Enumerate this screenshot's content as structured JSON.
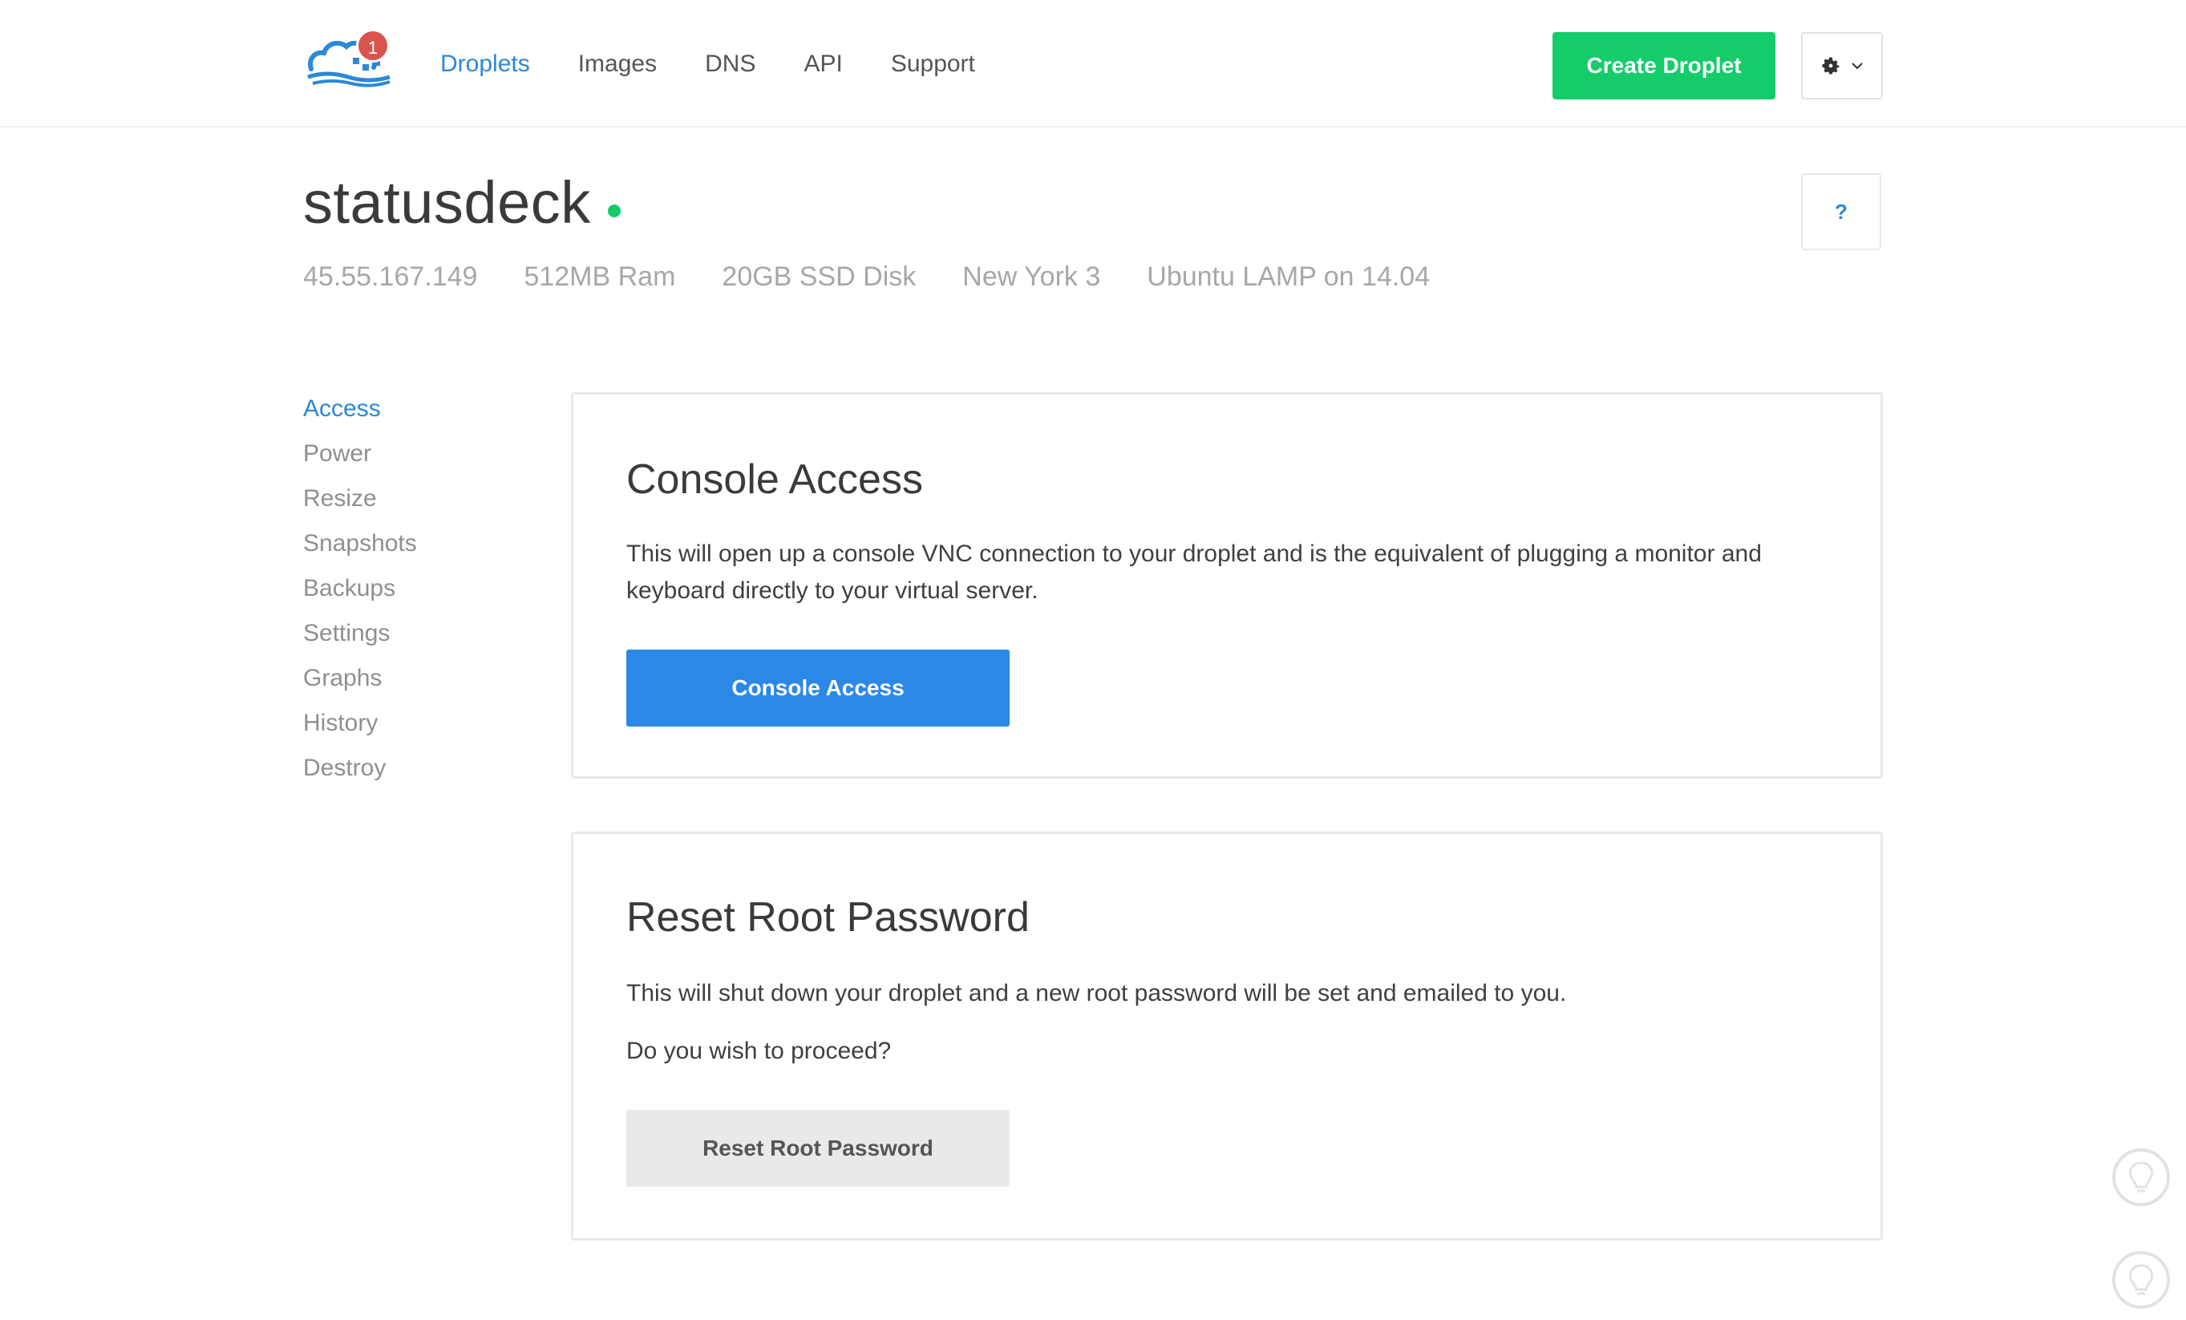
{
  "header": {
    "notification_count": "1",
    "nav": [
      "Droplets",
      "Images",
      "DNS",
      "API",
      "Support"
    ],
    "active_nav": "Droplets",
    "create_button": "Create Droplet"
  },
  "droplet": {
    "name": "statusdeck",
    "status": "active",
    "ip": "45.55.167.149",
    "ram": "512MB Ram",
    "disk": "20GB SSD Disk",
    "region": "New York 3",
    "image": "Ubuntu LAMP on 14.04"
  },
  "help_button": "?",
  "sidenav": {
    "items": [
      "Access",
      "Power",
      "Resize",
      "Snapshots",
      "Backups",
      "Settings",
      "Graphs",
      "History",
      "Destroy"
    ],
    "active": "Access"
  },
  "console_panel": {
    "title": "Console Access",
    "description": "This will open up a console VNC connection to your droplet and is the equivalent of plugging a monitor and keyboard directly to your virtual server.",
    "button": "Console Access"
  },
  "reset_panel": {
    "title": "Reset Root Password",
    "description": "This will shut down your droplet and a new root password will be set and emailed to you.",
    "question": "Do you wish to proceed?",
    "button": "Reset Root Password"
  },
  "colors": {
    "accent_blue": "#2b88d8",
    "green": "#15cc6b",
    "badge_red": "#d9534f"
  },
  "icons": [
    "digitalocean-logo-icon",
    "gear-icon",
    "chevron-down-icon",
    "lightbulb-icon"
  ]
}
